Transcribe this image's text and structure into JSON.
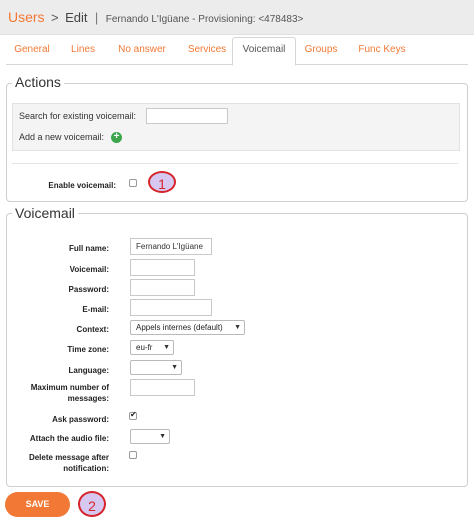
{
  "breadcrumb": {
    "root": "Users",
    "separator": ">",
    "current": "Edit",
    "divider": "|",
    "subtitle": "Fernando L'Igüane - Provisioning: <478483>"
  },
  "tabs": [
    {
      "label": "General",
      "active": false
    },
    {
      "label": "Lines",
      "active": false
    },
    {
      "label": "No answer",
      "active": false
    },
    {
      "label": "Services",
      "active": false
    },
    {
      "label": "Voicemail",
      "active": true
    },
    {
      "label": "Groups",
      "active": false
    },
    {
      "label": "Func Keys",
      "active": false
    }
  ],
  "actions": {
    "legend": "Actions",
    "search_label": "Search for existing voicemail:",
    "search_value": "",
    "add_label": "Add a new voicemail:",
    "enable_label": "Enable voicemail:",
    "enable_checked": false
  },
  "voicemail": {
    "legend": "Voicemail",
    "fields": {
      "full_name": {
        "label": "Full name:",
        "value": "Fernando L'Igüane"
      },
      "voicemail": {
        "label": "Voicemail:",
        "value": ""
      },
      "password": {
        "label": "Password:",
        "value": ""
      },
      "email": {
        "label": "E-mail:",
        "value": ""
      },
      "context": {
        "label": "Context:",
        "value": "Appels internes (default)"
      },
      "timezone": {
        "label": "Time zone:",
        "value": "eu-fr"
      },
      "language": {
        "label": "Language:",
        "value": ""
      },
      "max_messages": {
        "label": "Maximum number of messages:",
        "value": ""
      },
      "ask_password": {
        "label": "Ask password:",
        "checked": true
      },
      "attach_audio": {
        "label": "Attach the audio file:",
        "value": ""
      },
      "delete_after": {
        "label": "Delete message after notification:",
        "checked": false
      }
    }
  },
  "save_label": "SAVE",
  "markers": [
    "1",
    "2"
  ],
  "colors": {
    "accent": "#f27935",
    "marker_border": "#d5262c",
    "marker_fill": "#d6c8f0",
    "add_icon": "#3aa54b"
  }
}
